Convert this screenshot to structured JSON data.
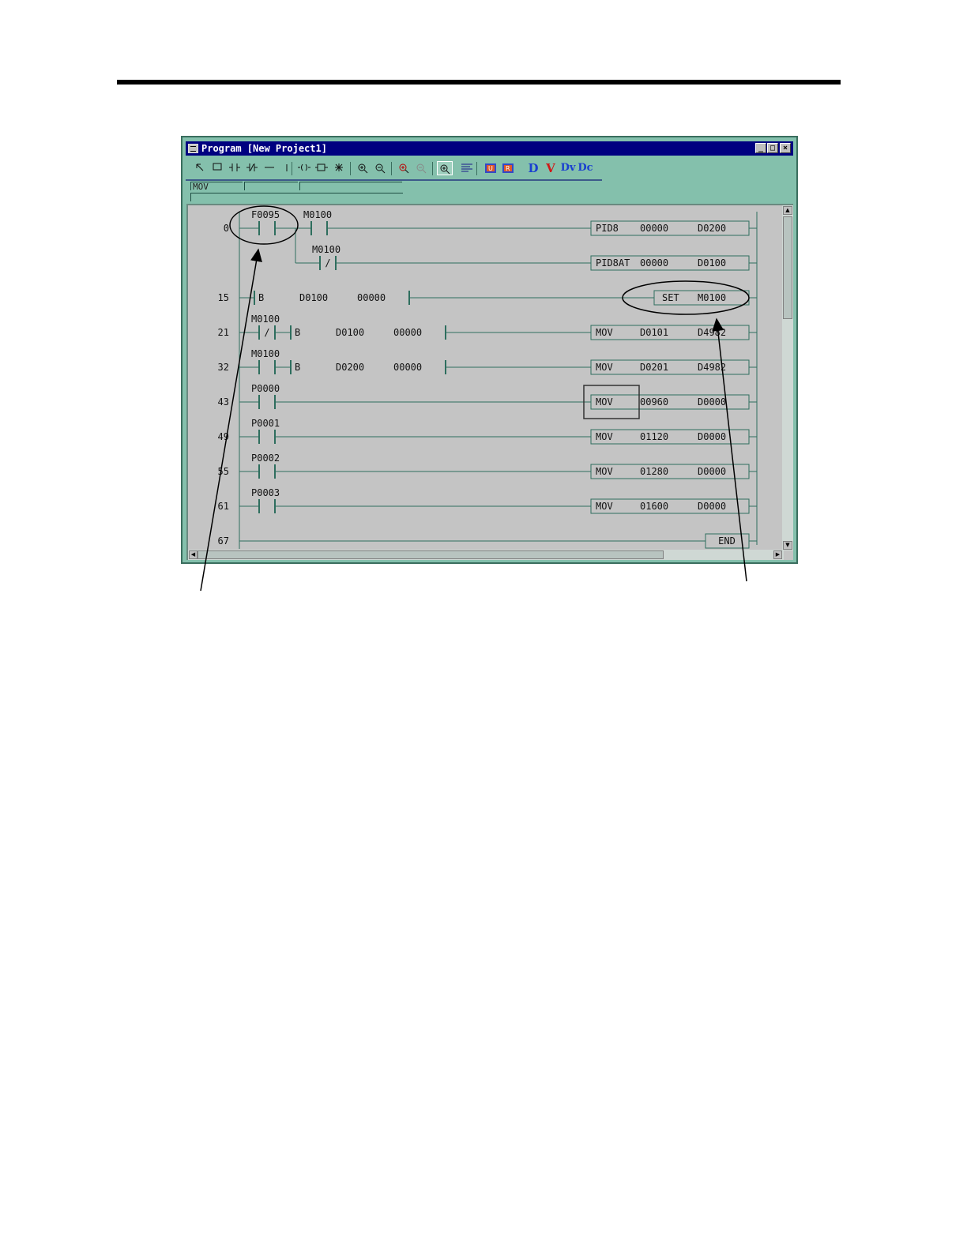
{
  "window": {
    "title": "Program [New Project1]",
    "controls": {
      "minimize": "_",
      "maximize": "□",
      "close": "×"
    }
  },
  "toolbar": {
    "tools": [
      {
        "name": "select-arrow-icon"
      },
      {
        "name": "rectangle-icon"
      },
      {
        "name": "open-contact-icon"
      },
      {
        "name": "closed-contact-icon"
      },
      {
        "name": "horizontal-line-icon"
      },
      {
        "name": "vertical-line-icon"
      },
      {
        "name": "coil-icon"
      },
      {
        "name": "function-box-icon"
      },
      {
        "name": "invert-icon"
      },
      {
        "name": "zoom-in-icon"
      },
      {
        "name": "zoom-out-icon"
      },
      {
        "name": "zoom-in-red-icon"
      },
      {
        "name": "zoom-out-red-icon"
      },
      {
        "name": "zoom-toggle-icon"
      },
      {
        "name": "comment-lines-icon"
      },
      {
        "name": "u-monitor-icon"
      },
      {
        "name": "r-monitor-icon"
      }
    ],
    "letter_buttons": [
      {
        "label": "D",
        "color": "#1a3fd0"
      },
      {
        "label": "V",
        "color": "#d01818"
      },
      {
        "label": "Dv",
        "color": "#1a3fd0"
      },
      {
        "label": "Dc",
        "color": "#1a3fd0"
      }
    ]
  },
  "instruction_bar": {
    "instruction": "MOV",
    "operand1": "",
    "operand2": ""
  },
  "ladder": {
    "colors": {
      "rung_line": "#2e6e5e",
      "background": "#c4c4c4"
    },
    "rungs": [
      {
        "step": "0",
        "contacts": [
          {
            "label": "F0095",
            "type": "NO"
          },
          {
            "label": "M0100",
            "type": "NO"
          }
        ],
        "instruction": {
          "op": "PID8",
          "args": [
            "00000",
            "D0200"
          ]
        },
        "branch": {
          "label": "M0100",
          "type": "NC",
          "instruction": {
            "op": "PID8AT",
            "args": [
              "00000",
              "D0100"
            ]
          }
        }
      },
      {
        "step": "15",
        "compare": {
          "op": "B",
          "args": [
            "D0100",
            "00000"
          ]
        },
        "instruction": {
          "op": "SET",
          "args": [
            "M0100"
          ]
        }
      },
      {
        "step": "21",
        "contacts": [
          {
            "label": "M0100",
            "type": "NC"
          }
        ],
        "compare": {
          "op": "B",
          "args": [
            "D0100",
            "00000"
          ]
        },
        "instruction": {
          "op": "MOV",
          "args": [
            "D0101",
            "D4982"
          ]
        }
      },
      {
        "step": "32",
        "contacts": [
          {
            "label": "M0100",
            "type": "NO"
          }
        ],
        "compare": {
          "op": "B",
          "args": [
            "D0200",
            "00000"
          ]
        },
        "instruction": {
          "op": "MOV",
          "args": [
            "D0201",
            "D4982"
          ]
        }
      },
      {
        "step": "43",
        "contacts": [
          {
            "label": "P0000",
            "type": "NO"
          }
        ],
        "instruction": {
          "op": "MOV",
          "args": [
            "00960",
            "D0000"
          ]
        }
      },
      {
        "step": "49",
        "contacts": [
          {
            "label": "P0001",
            "type": "NO"
          }
        ],
        "instruction": {
          "op": "MOV",
          "args": [
            "01120",
            "D0000"
          ]
        }
      },
      {
        "step": "55",
        "contacts": [
          {
            "label": "P0002",
            "type": "NO"
          }
        ],
        "instruction": {
          "op": "MOV",
          "args": [
            "01280",
            "D0000"
          ]
        }
      },
      {
        "step": "61",
        "contacts": [
          {
            "label": "P0003",
            "type": "NO"
          }
        ],
        "instruction": {
          "op": "MOV",
          "args": [
            "01600",
            "D0000"
          ]
        }
      },
      {
        "step": "67",
        "instruction": {
          "op": "END",
          "args": []
        }
      }
    ],
    "nc_mark": "/"
  }
}
